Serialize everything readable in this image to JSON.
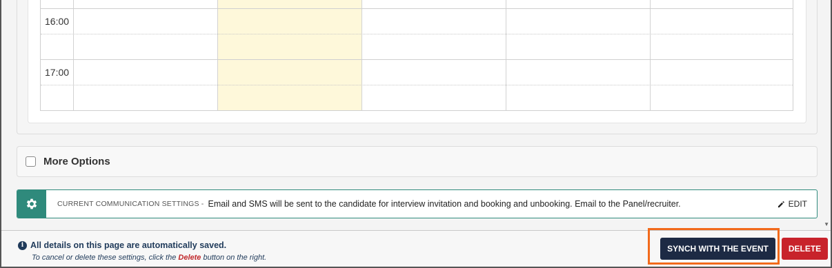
{
  "calendar": {
    "times": [
      "16:00",
      "17:00"
    ]
  },
  "more_options": {
    "label": "More Options",
    "checked": false
  },
  "communication": {
    "title": "CURRENT COMMUNICATION SETTINGS -",
    "text": "Email and SMS will be sent to the candidate for interview invitation and booking and unbooking. Email to the Panel/recruiter.",
    "edit_label": "EDIT",
    "icon": "gear-icon",
    "accent_color": "#2f8a7c"
  },
  "footer": {
    "autosave_text": "All details on this page are automatically saved.",
    "cancel_prefix": "To cancel or delete these settings, click the",
    "cancel_keyword": "Delete",
    "cancel_suffix": "button on the right.",
    "synch_label": "SYNCH WITH THE EVENT",
    "delete_label": "DELETE"
  },
  "colors": {
    "synch_button": "#1d2a44",
    "delete_button": "#c8232b",
    "highlight_outline": "#f26a1b",
    "calendar_highlight": "#fef8da"
  }
}
